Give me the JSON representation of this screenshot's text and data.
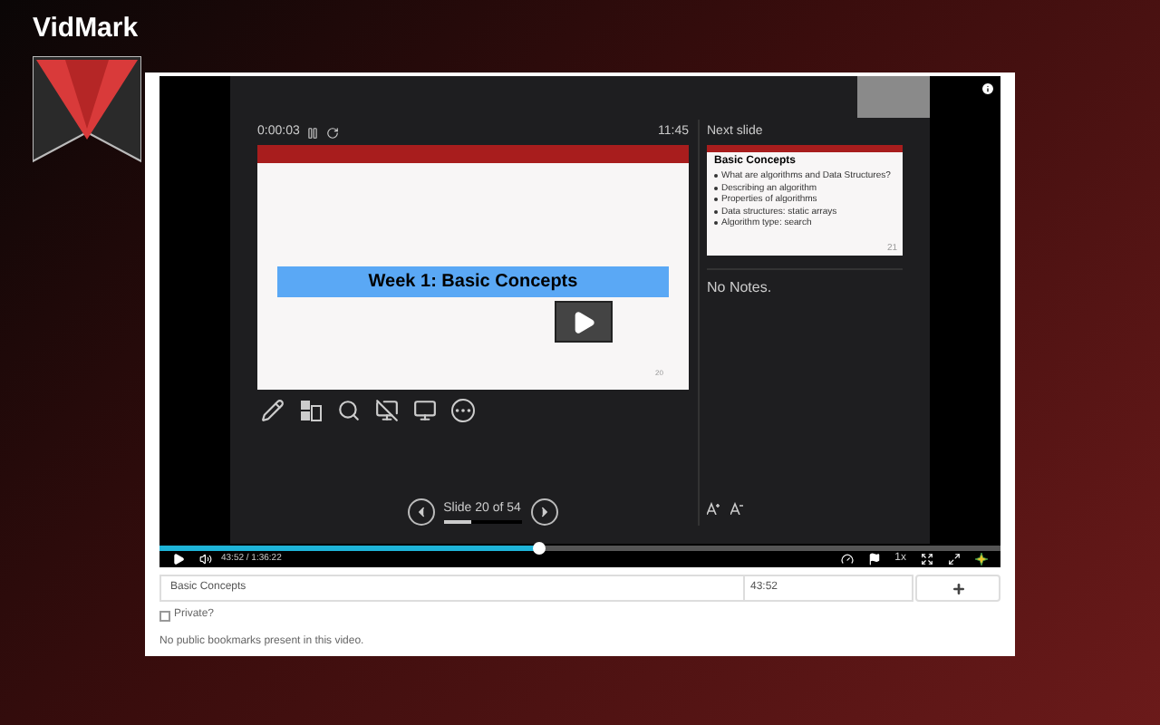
{
  "brand": {
    "name": "VidMark"
  },
  "presenter": {
    "elapsed": "0:00:03",
    "clock": "11:45",
    "slide": {
      "title": "Week 1: Basic Concepts",
      "number": "20"
    },
    "next_slide": {
      "label": "Next slide",
      "title": "Basic Concepts",
      "number": "21",
      "bullet_groups": [
        [
          "What are algorithms and Data Structures?"
        ],
        [
          "Describing an algorithm",
          "Properties of algorithms"
        ],
        [
          "Data structures: static arrays",
          "Algorithm type: search"
        ]
      ]
    },
    "notes": "No Notes.",
    "navigation": {
      "label": "Slide 20 of 54",
      "level": 0.37
    }
  },
  "player": {
    "level": 0.45,
    "time": "43:52 / 1:36:22",
    "speed": "1x"
  },
  "bookmark": {
    "title": "Basic Concepts",
    "time": "43:52"
  },
  "private": {
    "label": "Private?",
    "checked": false
  },
  "message": "No public bookmarks present in this video."
}
